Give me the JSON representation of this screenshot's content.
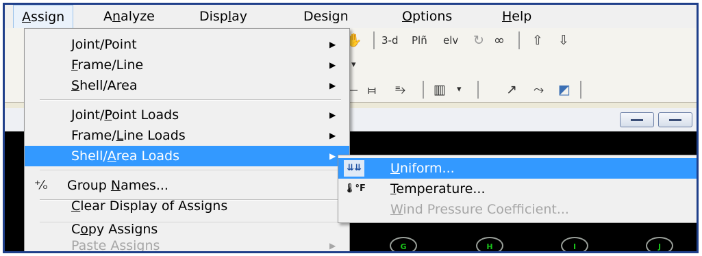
{
  "menubar": {
    "items": [
      {
        "label": "Assign",
        "underline": "A"
      },
      {
        "label": "Analyze",
        "underline": "n"
      },
      {
        "label": "Display",
        "underline": "l"
      },
      {
        "label": "Design",
        "underline": "g"
      },
      {
        "label": "Options",
        "underline": "O"
      },
      {
        "label": "Help",
        "underline": "H"
      }
    ]
  },
  "toolbar": {
    "row1": [
      "3-d",
      "Plñ",
      "elv"
    ],
    "row2": [],
    "row3": []
  },
  "assign_menu": {
    "items": [
      {
        "pre": "",
        "u": "J",
        "post": "oint/Point"
      },
      {
        "pre": "",
        "u": "F",
        "post": "rame/Line"
      },
      {
        "pre": "",
        "u": "S",
        "post": "hell/Area"
      },
      {
        "pre": "Joint/",
        "u": "P",
        "post": "oint Loads"
      },
      {
        "pre": "Frame/",
        "u": "L",
        "post": "ine Loads"
      },
      {
        "pre": "Shell/",
        "u": "A",
        "post": "rea Loads"
      },
      {
        "pre": "Group ",
        "u": "N",
        "post": "ames..."
      },
      {
        "pre": "",
        "u": "C",
        "post": "lear Display of Assigns"
      },
      {
        "pre": "C",
        "u": "o",
        "post": "py Assigns"
      },
      {
        "pre": "",
        "u": "",
        "post": "Paste Assigns"
      }
    ]
  },
  "shell_area_loads_submenu": {
    "items": [
      {
        "pre": "",
        "u": "U",
        "post": "niform..."
      },
      {
        "pre": "",
        "u": "T",
        "post": "emperature..."
      },
      {
        "pre": "",
        "u": "W",
        "post": "ind Pressure Coefficient..."
      }
    ]
  },
  "grid_bubbles": [
    "G",
    "H",
    "I",
    "J"
  ],
  "colors": {
    "highlight": "#3399ff",
    "menu_bg": "#f0f0f0",
    "disabled_text": "#a6a6a6",
    "canvas": "#000000",
    "frame_border": "#1f3f8a"
  }
}
